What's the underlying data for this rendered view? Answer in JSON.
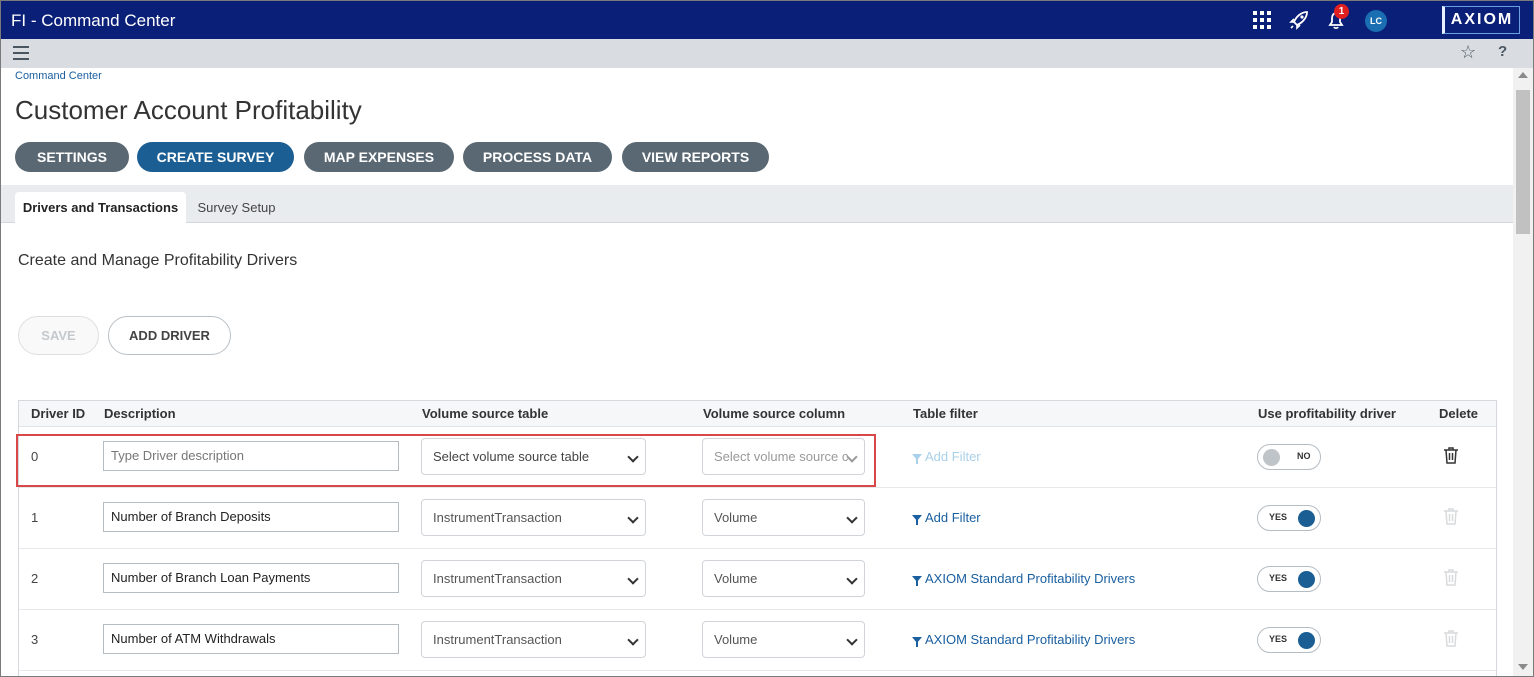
{
  "window": {
    "title": "FI - Command Center"
  },
  "topbar": {
    "notification_count": "1",
    "avatar_initials": "LC",
    "logo": "AXIOM",
    "accent_color": "#0a1f77"
  },
  "breadcrumb": "Command Center",
  "page_title": "Customer Account Profitability",
  "nav_buttons": [
    "SETTINGS",
    "CREATE SURVEY",
    "MAP EXPENSES",
    "PROCESS DATA",
    "VIEW REPORTS"
  ],
  "active_nav": "CREATE SURVEY",
  "tabs": [
    "Drivers and Transactions",
    "Survey Setup"
  ],
  "active_tab": "Drivers and Transactions",
  "section_title": "Create and Manage Profitability Drivers",
  "actions": {
    "save": "SAVE",
    "add_driver": "ADD DRIVER"
  },
  "table": {
    "headers": [
      "Driver ID",
      "Description",
      "Volume source table",
      "Volume source column",
      "Table filter",
      "Use profitability driver",
      "Delete"
    ],
    "rows": [
      {
        "id": "0",
        "description": "",
        "description_placeholder": "Type Driver description",
        "source_table": "Select volume source table",
        "source_column": "Select volume source c",
        "filter": "Add Filter",
        "toggle": "NO"
      },
      {
        "id": "1",
        "description": "Number of Branch Deposits",
        "source_table": "InstrumentTransaction",
        "source_column": "Volume",
        "filter": "Add Filter",
        "toggle": "YES"
      },
      {
        "id": "2",
        "description": "Number of Branch Loan Payments",
        "source_table": "InstrumentTransaction",
        "source_column": "Volume",
        "filter": "AXIOM Standard Profitability Drivers",
        "toggle": "YES"
      },
      {
        "id": "3",
        "description": "Number of ATM Withdrawals",
        "source_table": "InstrumentTransaction",
        "source_column": "Volume",
        "filter": "AXIOM Standard Profitability Drivers",
        "toggle": "YES"
      }
    ]
  }
}
